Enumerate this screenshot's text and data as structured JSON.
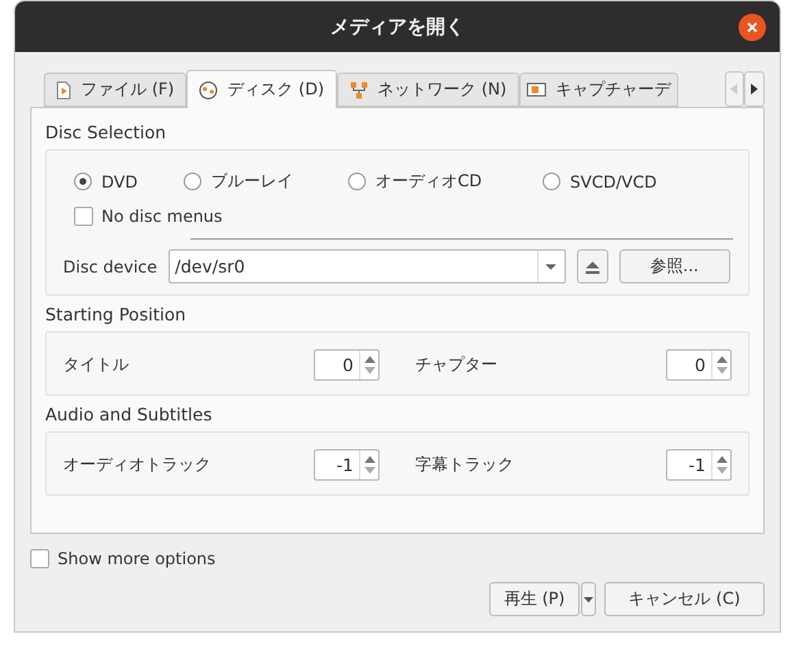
{
  "window": {
    "title": "メディアを開く"
  },
  "tabs": [
    {
      "label": "ファイル (F)",
      "kind": "file",
      "selected": false
    },
    {
      "label": "ディスク (D)",
      "kind": "disc",
      "selected": true
    },
    {
      "label": "ネットワーク (N)",
      "kind": "network",
      "selected": false
    },
    {
      "label": "キャプチャーデ",
      "kind": "capture",
      "selected": false
    }
  ],
  "disc_selection": {
    "title": "Disc Selection",
    "types": [
      {
        "label": "DVD",
        "selected": true
      },
      {
        "label": "ブルーレイ",
        "selected": false
      },
      {
        "label": "オーディオCD",
        "selected": false
      },
      {
        "label": "SVCD/VCD",
        "selected": false
      }
    ],
    "no_disc_menus": {
      "label": "No disc menus",
      "checked": false
    },
    "device": {
      "label": "Disc device",
      "value": "/dev/sr0"
    },
    "browse_button": "参照..."
  },
  "starting_position": {
    "title": "Starting Position",
    "fields": [
      {
        "label": "タイトル",
        "value": "0"
      },
      {
        "label": "チャプター",
        "value": "0"
      }
    ]
  },
  "audio_subtitles": {
    "title": "Audio and Subtitles",
    "fields": [
      {
        "label": "オーディオトラック",
        "value": "-1"
      },
      {
        "label": "字幕トラック",
        "value": "-1"
      }
    ]
  },
  "show_more_options": {
    "label": "Show more options",
    "checked": false
  },
  "buttons": {
    "play": "再生 (P)",
    "cancel": "キャンセル (C)"
  }
}
